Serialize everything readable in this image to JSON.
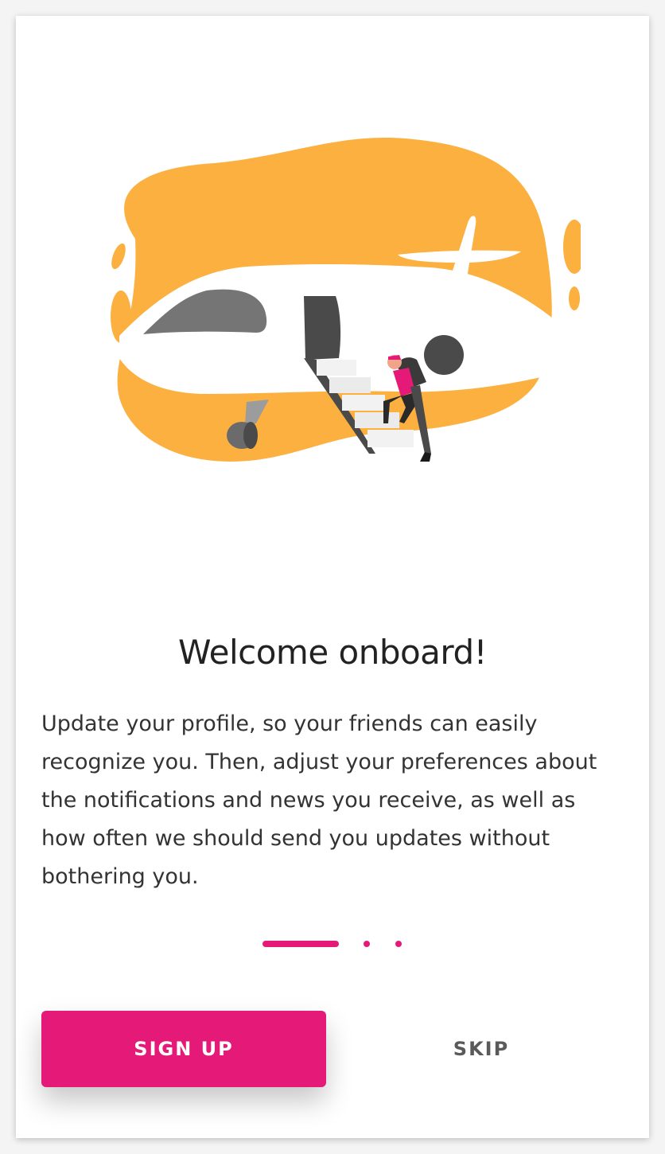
{
  "onboarding": {
    "title": "Welcome onboard!",
    "description": "Update your profile, so your friends can easily recognize you. Then, adjust your preferences about the notifications and news you receive, as well as how often we should send you updates without bothering you.",
    "pager": {
      "total_pages": 3,
      "current_page": 1
    },
    "buttons": {
      "signup_label": "SIGN UP",
      "skip_label": "SKIP"
    },
    "illustration": {
      "icon": "airplane-boarding-illustration"
    },
    "colors": {
      "accent": "#e51a78",
      "illustration_blob": "#fbb03f",
      "title_text": "#222222",
      "body_text": "#333333",
      "skip_text": "#5a5a5a"
    }
  }
}
